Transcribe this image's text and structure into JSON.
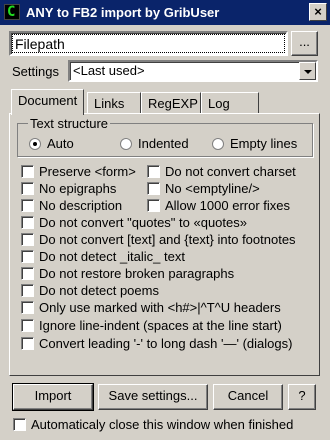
{
  "titlebar": {
    "title": "ANY to FB2 import by GribUser",
    "app_icon": "C",
    "close": "×"
  },
  "filepath": {
    "value": "Filepath",
    "browse_label": "..."
  },
  "settings": {
    "label": "Settings",
    "selected": "<Last used>"
  },
  "tabs": [
    {
      "label": "Document",
      "active": true
    },
    {
      "label": "Links"
    },
    {
      "label": "RegEXP"
    },
    {
      "label": "Log"
    }
  ],
  "text_structure": {
    "title": "Text structure",
    "options": [
      {
        "label": "Auto",
        "selected": true
      },
      {
        "label": "Indented",
        "selected": false
      },
      {
        "label": "Empty lines",
        "selected": false
      }
    ]
  },
  "checkboxes": {
    "preserve_form": "Preserve <form>",
    "no_convert_charset": "Do not convert charset",
    "no_epigraphs": "No epigraphs",
    "no_emptyline": "No <emptyline/>",
    "no_description": "No description",
    "allow_1000_errors": "Allow 1000 error fixes",
    "no_quotes": "Do not convert \"quotes\" to «quotes»",
    "no_footnotes": "Do not convert [text] and {text} into footnotes",
    "no_italic": "Do not detect _italic_ text",
    "no_restore_paragraphs": "Do not restore broken paragraphs",
    "no_poems": "Do not detect poems",
    "only_headers": "Only use marked with <h#>|^T^U headers",
    "ignore_indent": "Ignore line-indent (spaces at the line start)",
    "convert_dash": "Convert leading '-' to long dash '—' (dialogs)"
  },
  "buttons": {
    "import": "Import",
    "save_settings": "Save settings...",
    "cancel": "Cancel",
    "help": "?"
  },
  "auto_close": {
    "label": "Automaticaly close this window when finished",
    "checked": false
  }
}
